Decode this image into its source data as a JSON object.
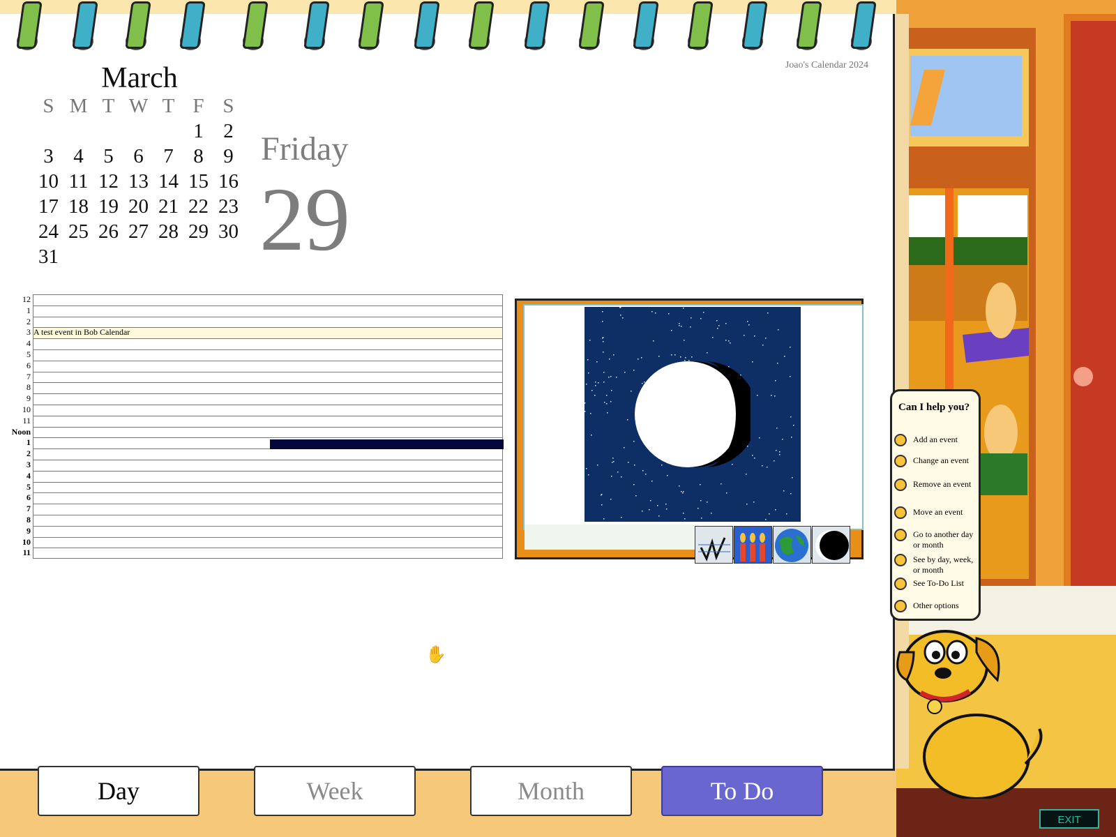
{
  "app": {
    "book_title": "Joao's Calendar 2024"
  },
  "mini_calendar": {
    "month": "March",
    "weekday_headers": [
      "S",
      "M",
      "T",
      "W",
      "T",
      "F",
      "S"
    ],
    "weeks": [
      [
        "",
        "",
        "",
        "",
        "",
        "1",
        "2"
      ],
      [
        "3",
        "4",
        "5",
        "6",
        "7",
        "8",
        "9"
      ],
      [
        "10",
        "11",
        "12",
        "13",
        "14",
        "15",
        "16"
      ],
      [
        "17",
        "18",
        "19",
        "20",
        "21",
        "22",
        "23"
      ],
      [
        "24",
        "25",
        "26",
        "27",
        "28",
        "29",
        "30"
      ],
      [
        "31",
        "",
        "",
        "",
        "",
        "",
        ""
      ]
    ]
  },
  "selected_day": {
    "weekday": "Friday",
    "day": "29"
  },
  "schedule": {
    "hours": [
      "12",
      "1",
      "2",
      "3",
      "4",
      "5",
      "6",
      "7",
      "8",
      "9",
      "10",
      "11",
      "Noon",
      "1",
      "2",
      "3",
      "4",
      "5",
      "6",
      "7",
      "8",
      "9",
      "10",
      "11"
    ],
    "events": [
      {
        "hour_index": 3,
        "text": "A test event in Bob Calendar"
      }
    ]
  },
  "moon_panel": {
    "tabs": [
      "notes-icon",
      "candles-icon",
      "globe-icon",
      "moon-phase-icon"
    ]
  },
  "help_balloon": {
    "title": "Can I help you?",
    "options": [
      "Add an event",
      "Change an event",
      "Remove an event",
      "Move an event",
      "Go to another day or month",
      "See by day, week, or month",
      "See To-Do List",
      "Other options"
    ]
  },
  "tabs": {
    "day": "Day",
    "week": "Week",
    "month": "Month",
    "todo": "To Do"
  },
  "exit_label": "EXIT",
  "colors": {
    "page": "#ffffff",
    "todo_tab": "#6a66cf",
    "sky": "#0d2f66",
    "event_highlight": "#fcf9dc"
  }
}
